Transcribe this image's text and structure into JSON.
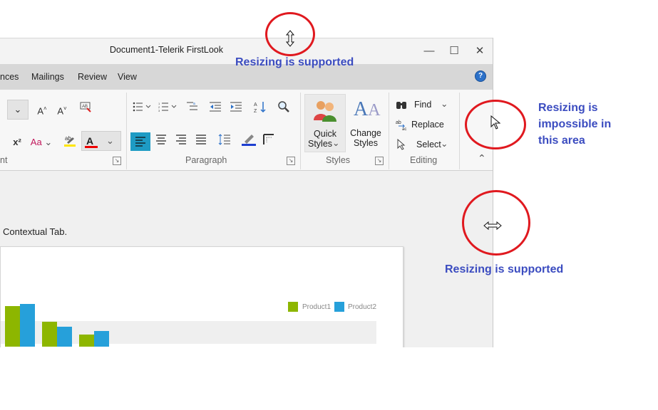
{
  "window": {
    "title": "Document1-Telerik FirstLook",
    "controls": {
      "minimize": "—",
      "maximize": "☐",
      "close": "✕"
    }
  },
  "menu": {
    "tabs": [
      "nces",
      "Mailings",
      "Review",
      "View"
    ],
    "help": "?"
  },
  "ribbon": {
    "font_group": {
      "label": "nt",
      "grow_font": "A",
      "shrink_font": "A",
      "superscript": "x²",
      "text_effects": "Aa",
      "font_color": "A"
    },
    "paragraph_group": {
      "label": "Paragraph"
    },
    "styles_group": {
      "label": "Styles",
      "quick_styles_line1": "Quick",
      "quick_styles_line2": "Styles",
      "change_styles_line1": "Change",
      "change_styles_line2": "Styles"
    },
    "editing_group": {
      "label": "Editing",
      "find": "Find",
      "replace": "Replace",
      "select": "Select"
    }
  },
  "document": {
    "text": "Contextual Tab.",
    "chart_data": {
      "type": "bar",
      "series": [
        {
          "name": "Product1",
          "color": "#8db600",
          "values": [
            57,
            35,
            17
          ]
        },
        {
          "name": "Product2",
          "color": "#26a0da",
          "values": [
            60,
            28,
            22
          ]
        }
      ],
      "legend_placement": "top-right"
    }
  },
  "annotations": {
    "top": "Resizing is supported",
    "right_line1": "Resizing is",
    "right_line2": "impossible in",
    "right_line3": "this area",
    "bottom": "Resizing is supported",
    "color": "#3b4cc0",
    "circle_color": "#e0191f"
  }
}
